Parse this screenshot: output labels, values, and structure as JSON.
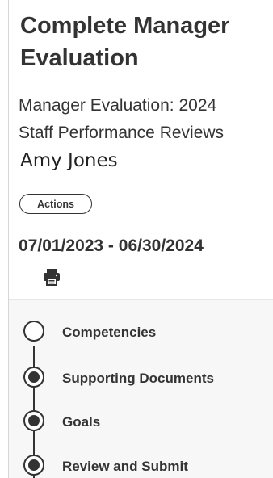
{
  "header": {
    "title": "Complete Manager Evaluation",
    "subtitle_line1": "Manager Evaluation: 2024",
    "subtitle_line2": "Staff Performance Reviews",
    "worker_name": "Amy Jones"
  },
  "actions": {
    "label": "Actions"
  },
  "review_period": "07/01/2023 - 06/30/2024",
  "icons": {
    "print": "print-icon"
  },
  "colors": {
    "text": "#333333",
    "steps_background": "#f7f7f7",
    "border": "#d6d6d6"
  },
  "steps": [
    {
      "label": "Competencies",
      "state": "current"
    },
    {
      "label": "Supporting Documents",
      "state": "pending"
    },
    {
      "label": "Goals",
      "state": "pending"
    },
    {
      "label": "Review and Submit",
      "state": "pending"
    }
  ]
}
